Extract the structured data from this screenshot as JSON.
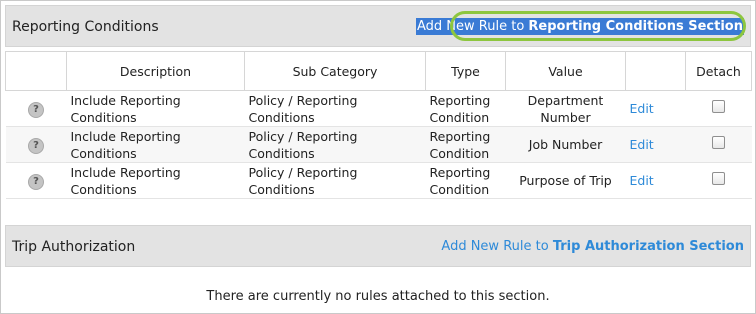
{
  "sections": [
    {
      "title": "Reporting Conditions",
      "add_rule_prefix": "Add New Rule to ",
      "add_rule_name": "Reporting Conditions Section"
    },
    {
      "title": "Trip Authorization",
      "add_rule_prefix": "Add New Rule to ",
      "add_rule_name": "Trip Authorization Section",
      "empty_message": "There are currently no rules attached to this section."
    }
  ],
  "table": {
    "columns": [
      "",
      "Description",
      "Sub Category",
      "Type",
      "Value",
      "",
      "Detach"
    ],
    "rows": [
      {
        "icon": "?",
        "description": "Include Reporting Conditions",
        "sub_category": "Policy / Reporting Conditions",
        "type": "Reporting Condition",
        "value": "Department Number",
        "edit": "Edit"
      },
      {
        "icon": "?",
        "description": "Include Reporting Conditions",
        "sub_category": "Policy / Reporting Conditions",
        "type": "Reporting Condition",
        "value": "Job Number",
        "edit": "Edit"
      },
      {
        "icon": "?",
        "description": "Include Reporting Conditions",
        "sub_category": "Policy / Reporting Conditions",
        "type": "Reporting Condition",
        "value": "Purpose of Trip",
        "edit": "Edit"
      }
    ]
  },
  "colors": {
    "link": "#2e8ad8",
    "highlight_ring": "#8dc63f",
    "selection": "#3a7bd5",
    "header_bg": "#e3e3e3"
  }
}
